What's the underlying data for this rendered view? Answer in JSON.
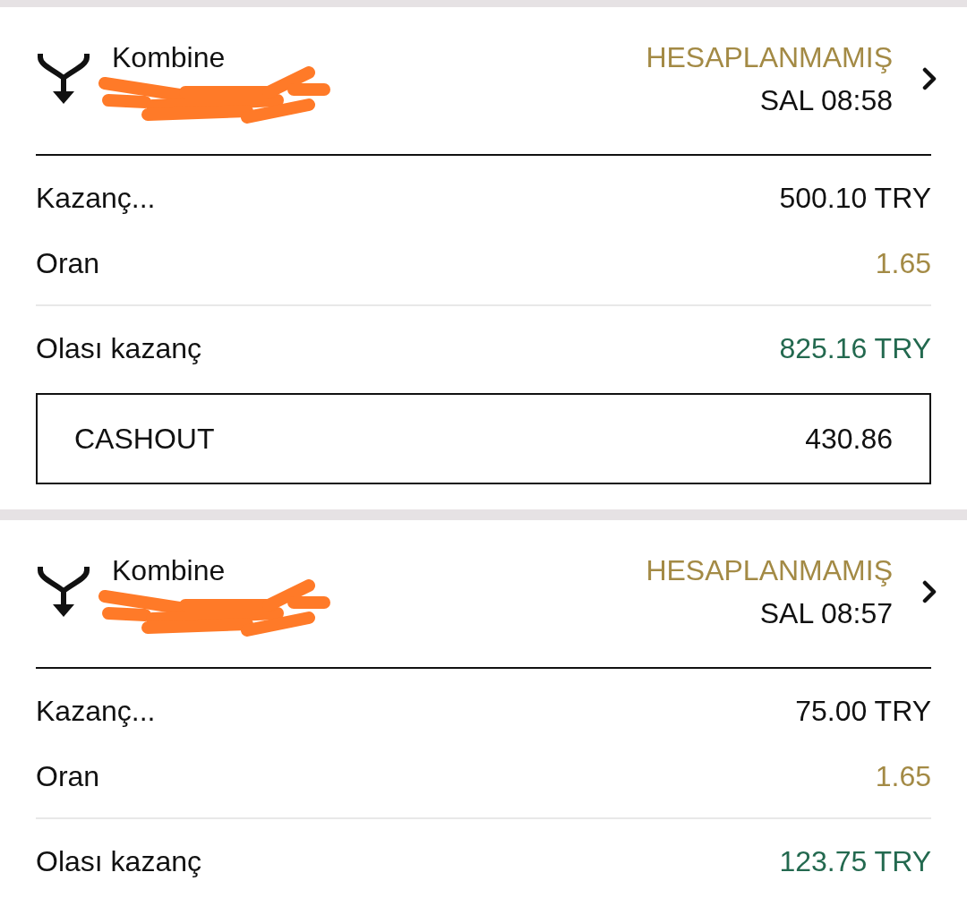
{
  "bets": [
    {
      "type": "Kombine",
      "id_redacted": true,
      "status": "HESAPLANMAMIŞ",
      "time": "SAL 08:58",
      "rows": [
        {
          "kind": "stake",
          "label": "Kazanç...",
          "value": "500.10 TRY"
        },
        {
          "kind": "odds",
          "label": "Oran",
          "value": "1.65"
        },
        {
          "kind": "payout",
          "label": "Olası kazanç",
          "value": "825.16 TRY"
        }
      ],
      "cashout": {
        "label": "CASHOUT",
        "amount": "430.86"
      }
    },
    {
      "type": "Kombine",
      "id_redacted": true,
      "status": "HESAPLANMAMIŞ",
      "time": "SAL 08:57",
      "rows": [
        {
          "kind": "stake",
          "label": "Kazanç...",
          "value": "75.00 TRY"
        },
        {
          "kind": "odds",
          "label": "Oran",
          "value": "1.65"
        },
        {
          "kind": "payout",
          "label": "Olası kazanç",
          "value": "123.75 TRY"
        }
      ]
    }
  ]
}
